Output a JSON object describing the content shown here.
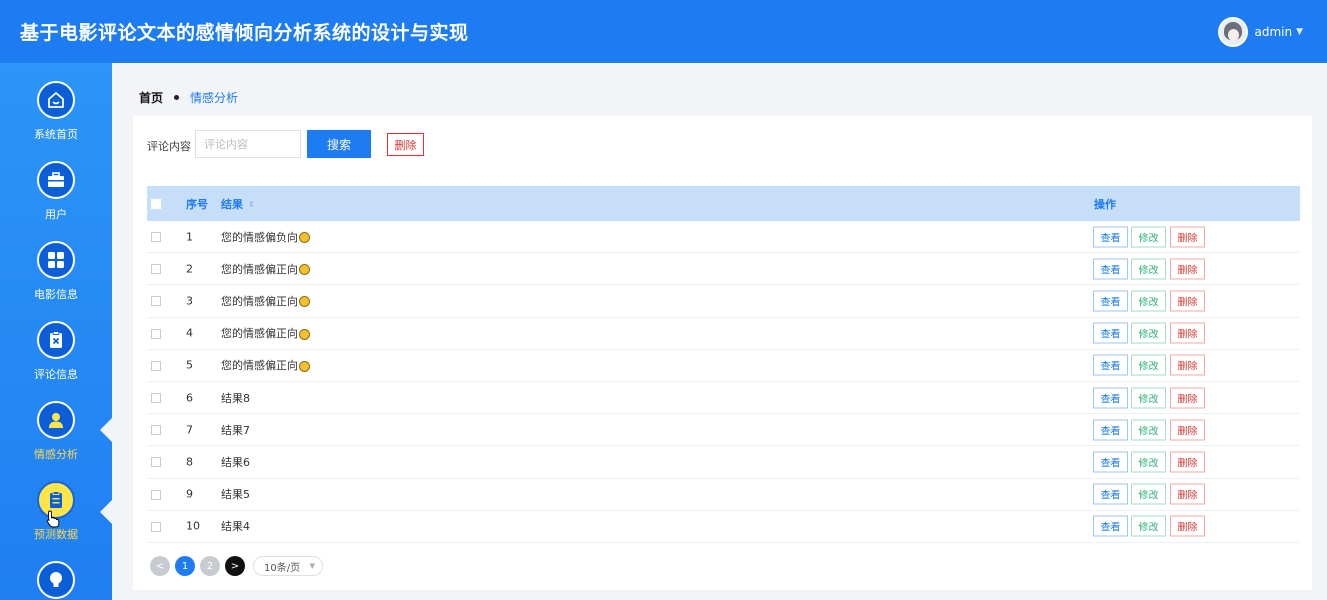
{
  "header": {
    "title": "基于电影评论文本的感情倾向分析系统的设计与实现",
    "username": "admin"
  },
  "sidebar": {
    "items": [
      {
        "label": "系统首页",
        "icon": "home-icon"
      },
      {
        "label": "用户",
        "icon": "briefcase-icon"
      },
      {
        "label": "电影信息",
        "icon": "grid-icon"
      },
      {
        "label": "评论信息",
        "icon": "clipboard-x-icon"
      },
      {
        "label": "情感分析",
        "icon": "user-icon"
      },
      {
        "label": "预测数据",
        "icon": "clipboard-icon"
      },
      {
        "label": "",
        "icon": "lightbulb-icon"
      }
    ]
  },
  "breadcrumb": {
    "home": "首页",
    "current": "情感分析"
  },
  "search": {
    "label": "评论内容",
    "placeholder": "评论内容",
    "search_label": "搜索",
    "delete_label": "删除"
  },
  "table": {
    "columns": {
      "index": "序号",
      "result": "结果",
      "actions": "操作"
    },
    "rows": [
      {
        "index": "1",
        "result": "您的情感偏负向",
        "emoji": "sad"
      },
      {
        "index": "2",
        "result": "您的情感偏正向",
        "emoji": "happy"
      },
      {
        "index": "3",
        "result": "您的情感偏正向",
        "emoji": "happy"
      },
      {
        "index": "4",
        "result": "您的情感偏正向",
        "emoji": "happy"
      },
      {
        "index": "5",
        "result": "您的情感偏正向",
        "emoji": "happy"
      },
      {
        "index": "6",
        "result": "结果8",
        "emoji": ""
      },
      {
        "index": "7",
        "result": "结果7",
        "emoji": ""
      },
      {
        "index": "8",
        "result": "结果6",
        "emoji": ""
      },
      {
        "index": "9",
        "result": "结果5",
        "emoji": ""
      },
      {
        "index": "10",
        "result": "结果4",
        "emoji": ""
      }
    ],
    "actions": {
      "view": "查看",
      "edit": "修改",
      "delete": "删除"
    }
  },
  "pagination": {
    "prev": "<",
    "pages": [
      "1",
      "2"
    ],
    "current": "1",
    "next": ">",
    "page_size": "10条/页"
  },
  "colors": {
    "primary": "#1e7cf2",
    "danger": "#e0342f",
    "success": "#2eb37a",
    "active_nav": "#ffd84d"
  }
}
